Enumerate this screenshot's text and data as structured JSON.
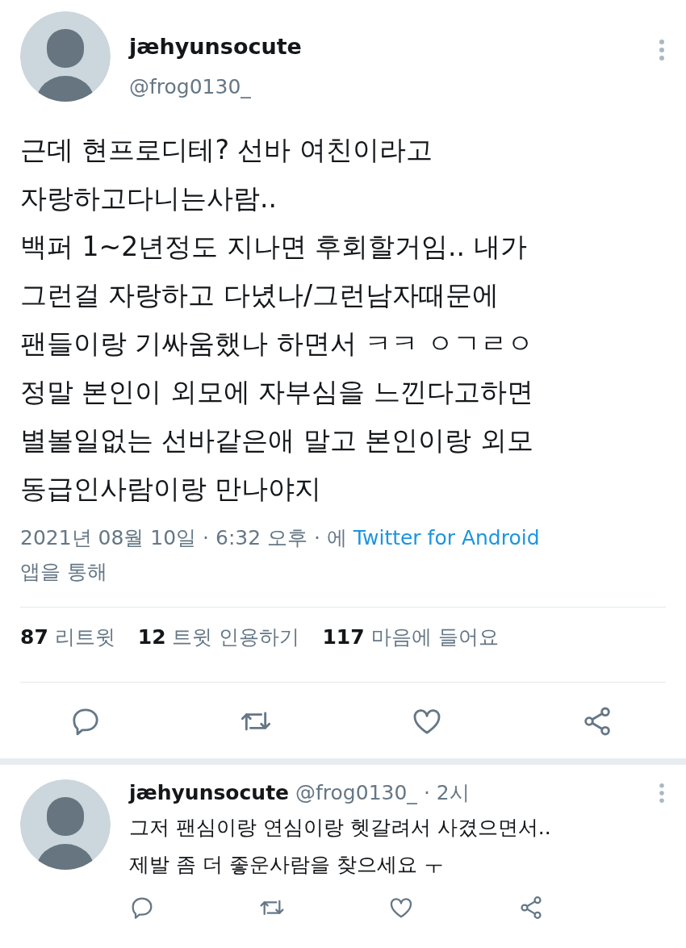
{
  "tweet": {
    "name": "jæhyunsocute",
    "handle": "@frog0130_",
    "lines": [
      "근데 현프로디테? 선바 여친이라고",
      "자랑하고다니는사람..",
      "백퍼 1~2년정도 지나면 후회할거임.. 내가",
      "그런걸 자랑하고 다녔나/그런남자때문에",
      "팬들이랑 기싸움했나 하면서 ㅋㅋ ㅇㄱㄹㅇ",
      "정말 본인이 외모에 자부심을 느낀다고하면",
      "별볼일없는 선바같은애 말고 본인이랑 외모",
      "동급인사람이랑 만나야지"
    ],
    "meta_before": "2021년 08월 10일 · 6:32 오후 · 에",
    "source_link": "Twitter for Android",
    "meta_after": "앱을 통해",
    "stats": [
      "**87** 리트윗",
      "**12** 트윗 인용하기",
      "**117** 마음에 들어요"
    ]
  },
  "reply": {
    "name": "jæhyunsocute",
    "handle": "@frog0130_",
    "time": "· 2시",
    "lines": [
      "그저 팬심이랑 연심이랑 헷갈려서 사겼으면서..",
      "제발 좀 더 좋운사람을 찾으세요 ㅜ"
    ]
  }
}
